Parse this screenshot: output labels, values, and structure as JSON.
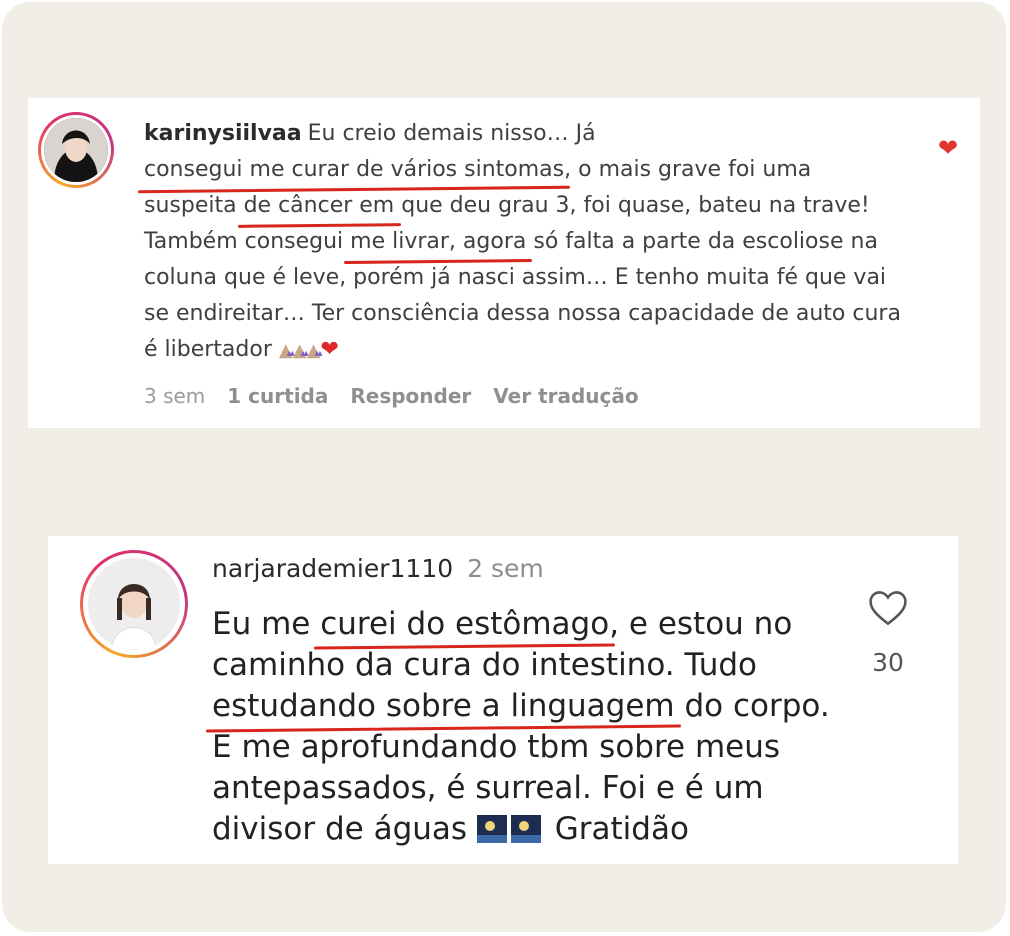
{
  "comment1": {
    "username": "karinysiilvaa",
    "text_parts": [
      "Eu creio demais nisso… Já ",
      "consegui me curar de vários sintomas",
      ", o mais grave foi uma suspeita ",
      "de câncer em",
      " que deu grau 3, foi quase, bateu na trave! Também consegui ",
      "me livrar, agora",
      " só falta a parte da escoliose na coluna que é leve, porém já nasci assim… E tenho muita fé que vai se endireitar… Ter consciência dessa nossa capacidade de auto cura é libertador"
    ],
    "emojis": [
      "folded-hands",
      "folded-hands",
      "folded-hands",
      "red-heart"
    ],
    "time": "3 sem",
    "likes": "1 curtida",
    "reply": "Responder",
    "translate": "Ver tradução",
    "liked": true
  },
  "comment2": {
    "username": "narjarademier1110",
    "time": "2 sem",
    "text_parts": [
      "Eu me ",
      "curei do estômago",
      ", e estou no caminho da cura do intestino. Tudo ",
      "estudando sobre a linguagem",
      " do corpo. E me aprofundando tbm sobre meus antepassados, é surreal. Foi e é um divisor de águas",
      " Gratidão"
    ],
    "emojis": [
      "night-sky",
      "night-sky"
    ],
    "like_count": "30"
  },
  "colors": {
    "background": "#f1ede7",
    "underline": "#d9261c",
    "heart": "#e2362c"
  }
}
